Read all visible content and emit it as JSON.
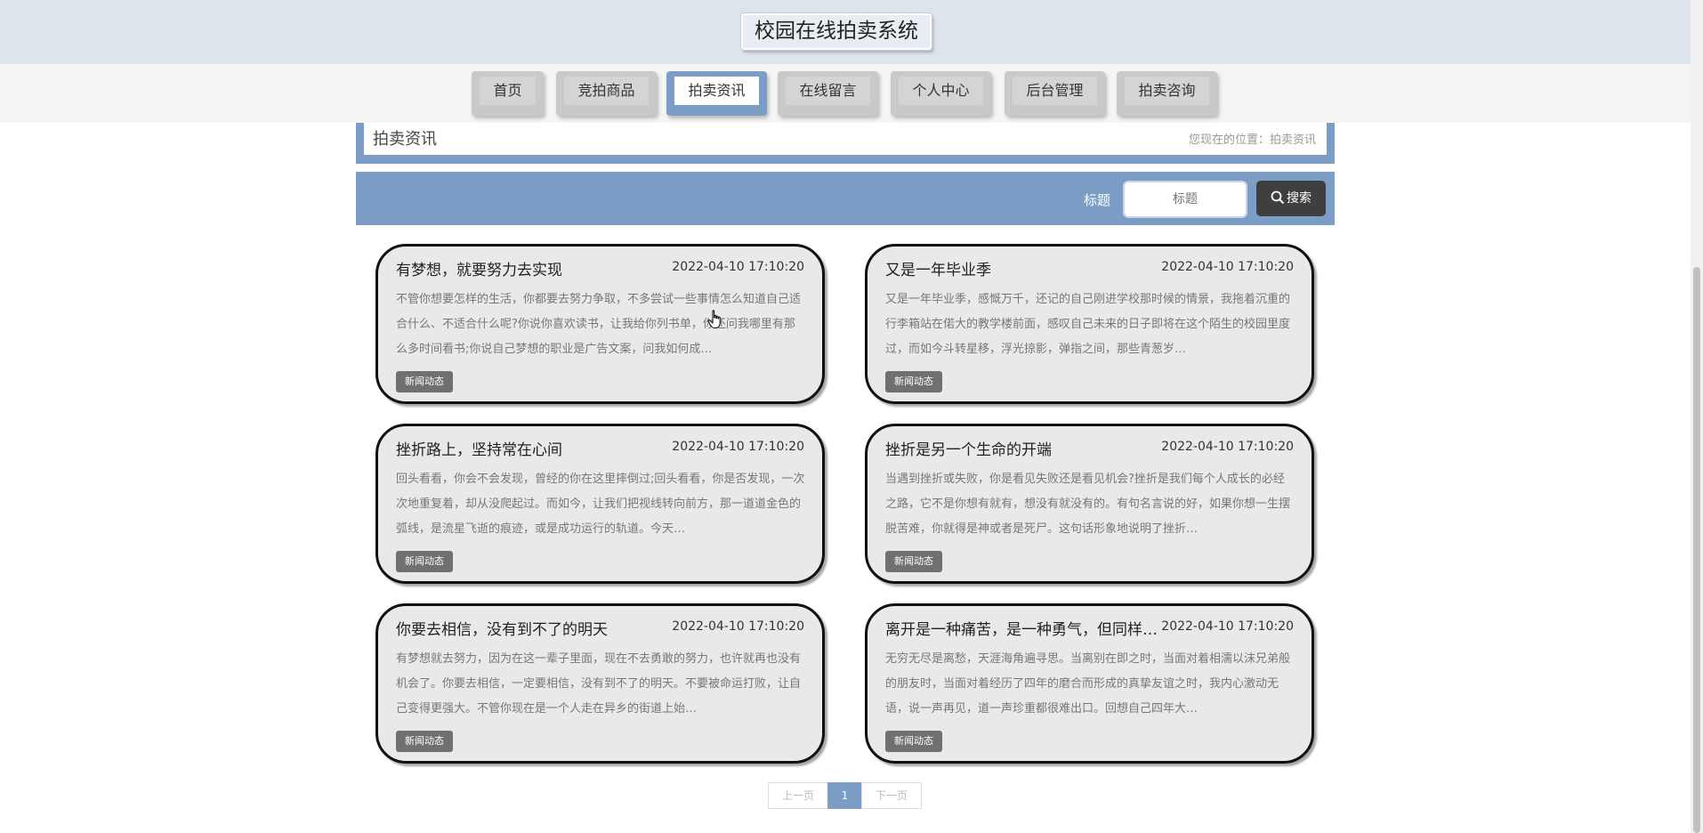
{
  "site": {
    "title": "校园在线拍卖系统"
  },
  "nav": {
    "items": [
      {
        "label": "首页",
        "active": false
      },
      {
        "label": "竞拍商品",
        "active": false
      },
      {
        "label": "拍卖资讯",
        "active": true
      },
      {
        "label": "在线留言",
        "active": false
      },
      {
        "label": "个人中心",
        "active": false
      },
      {
        "label": "后台管理",
        "active": false
      },
      {
        "label": "拍卖咨询",
        "active": false
      }
    ]
  },
  "breadcrumb": {
    "title": "拍卖资讯",
    "location": "您现在的位置：拍卖资讯"
  },
  "search": {
    "label": "标题",
    "placeholder": "标题",
    "button": "搜索"
  },
  "articles": [
    {
      "title": "有梦想，就要努力去实现",
      "date": "2022-04-10 17:10:20",
      "excerpt": "不管你想要怎样的生活，你都要去努力争取，不多尝试一些事情怎么知道自己适合什么、不适合什么呢?你说你喜欢读书，让我给你列书单，你还问我哪里有那么多时间看书;你说自己梦想的职业是广告文案，问我如何成…",
      "tag": "新闻动态"
    },
    {
      "title": "又是一年毕业季",
      "date": "2022-04-10 17:10:20",
      "excerpt": "又是一年毕业季，感慨万千，还记的自己刚进学校那时候的情景，我拖着沉重的行李箱站在偌大的教学楼前面，感叹自己未来的日子即将在这个陌生的校园里度过，而如今斗转星移，浮光掠影，弹指之间，那些青葱岁…",
      "tag": "新闻动态"
    },
    {
      "title": "挫折路上，坚持常在心间",
      "date": "2022-04-10 17:10:20",
      "excerpt": "回头看看，你会不会发现，曾经的你在这里摔倒过;回头看看，你是否发现，一次次地重复着，却从没爬起过。而如今，让我们把视线转向前方，那一道道金色的弧线，是流星飞逝的痕迹，或是成功运行的轨道。今天…",
      "tag": "新闻动态"
    },
    {
      "title": "挫折是另一个生命的开端",
      "date": "2022-04-10 17:10:20",
      "excerpt": "当遇到挫折或失败，你是看见失败还是看见机会?挫折是我们每个人成长的必经之路，它不是你想有就有，想没有就没有的。有句名言说的好，如果你想一生摆脱苦难，你就得是神或者是死尸。这句话形象地说明了挫折…",
      "tag": "新闻动态"
    },
    {
      "title": "你要去相信，没有到不了的明天",
      "date": "2022-04-10 17:10:20",
      "excerpt": "有梦想就去努力，因为在这一辈子里面，现在不去勇敢的努力，也许就再也没有机会了。你要去相信，一定要相信，没有到不了的明天。不要被命运打败，让自己变得更强大。不管你现在是一个人走在异乡的街道上始…",
      "tag": "新闻动态"
    },
    {
      "title": "离开是一种痛苦，是一种勇气，但同样…",
      "date": "2022-04-10 17:10:20",
      "excerpt": "无穷无尽是离愁，天涯海角遍寻思。当离别在即之时，当面对着相濡以沫兄弟般的朋友时，当面对着经历了四年的磨合而形成的真挚友谊之时，我内心激动无语，说一声再见，道一声珍重都很难出口。回想自己四年大…",
      "tag": "新闻动态"
    }
  ],
  "pagination": {
    "prev": "上一页",
    "current": "1",
    "next": "下一页"
  }
}
